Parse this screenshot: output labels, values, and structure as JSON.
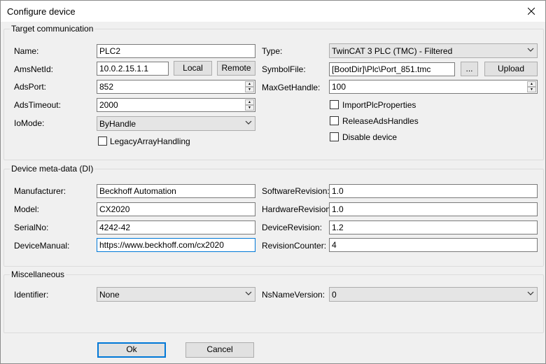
{
  "window": {
    "title": "Configure device"
  },
  "target": {
    "legend": "Target communication",
    "name_label": "Name:",
    "name_value": "PLC2",
    "amsnetid_label": "AmsNetId:",
    "amsnetid_value": "10.0.2.15.1.1",
    "local_button": "Local",
    "remote_button": "Remote",
    "adsport_label": "AdsPort:",
    "adsport_value": "852",
    "adstimeout_label": "AdsTimeout:",
    "adstimeout_value": "2000",
    "iomode_label": "IoMode:",
    "iomode_value": "ByHandle",
    "legacy_label": "LegacyArrayHandling",
    "legacy_checked": false,
    "type_label": "Type:",
    "type_value": "TwinCAT 3 PLC (TMC) - Filtered",
    "symbolfile_label": "SymbolFile:",
    "symbolfile_value": "[BootDir]\\Plc\\Port_851.tmc",
    "browse_button": "...",
    "upload_button": "Upload",
    "maxgethandle_label": "MaxGetHandle:",
    "maxgethandle_value": "100",
    "importplc_label": "ImportPlcProperties",
    "importplc_checked": false,
    "releaseads_label": "ReleaseAdsHandles",
    "releaseads_checked": false,
    "disable_label": "Disable device",
    "disable_checked": false
  },
  "meta": {
    "legend": "Device meta-data (DI)",
    "manufacturer_label": "Manufacturer:",
    "manufacturer_value": "Beckhoff Automation",
    "model_label": "Model:",
    "model_value": "CX2020",
    "serial_label": "SerialNo:",
    "serial_value": "4242-42",
    "manual_label": "DeviceManual:",
    "manual_value": "https://www.beckhoff.com/cx2020",
    "swrev_label": "SoftwareRevision:",
    "swrev_value": "1.0",
    "hwrev_label": "HardwareRevision:",
    "hwrev_value": "1.0",
    "devrev_label": "DeviceRevision:",
    "devrev_value": "1.2",
    "revcounter_label": "RevisionCounter:",
    "revcounter_value": "4"
  },
  "misc": {
    "legend": "Miscellaneous",
    "identifier_label": "Identifier:",
    "identifier_value": "None",
    "nsname_label": "NsNameVersion:",
    "nsname_value": "0"
  },
  "buttons": {
    "ok": "Ok",
    "cancel": "Cancel"
  }
}
